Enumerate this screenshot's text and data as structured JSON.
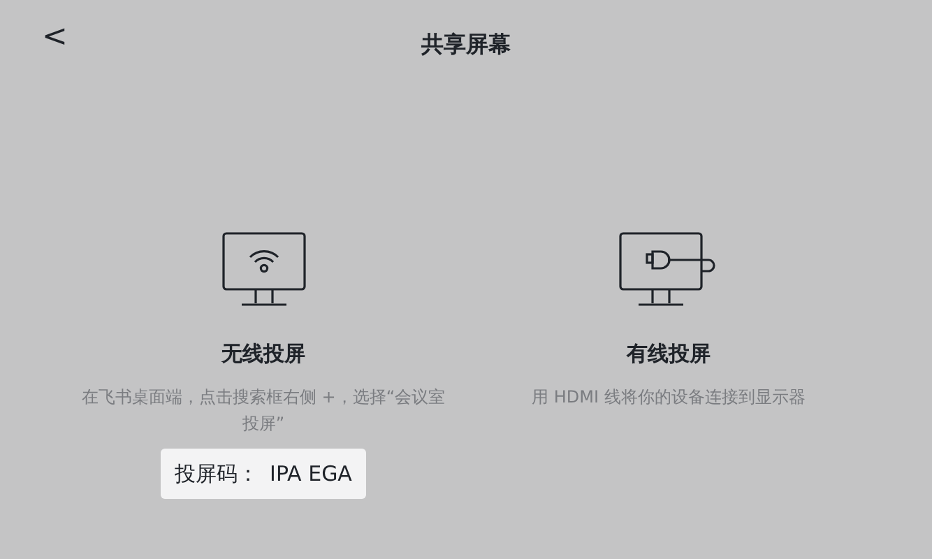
{
  "header": {
    "back": "<",
    "title": "共享屏幕"
  },
  "options": [
    {
      "kind": "wireless",
      "title": "无线投屏",
      "description": "在飞书桌面端，点击搜索框右侧 +，选择“会议室投屏”",
      "code": {
        "label": "投屏码：",
        "value": "IPA EGA"
      }
    },
    {
      "kind": "wired",
      "title": "有线投屏",
      "description": "用 HDMI 线将你的设备连接到显示器"
    }
  ]
}
